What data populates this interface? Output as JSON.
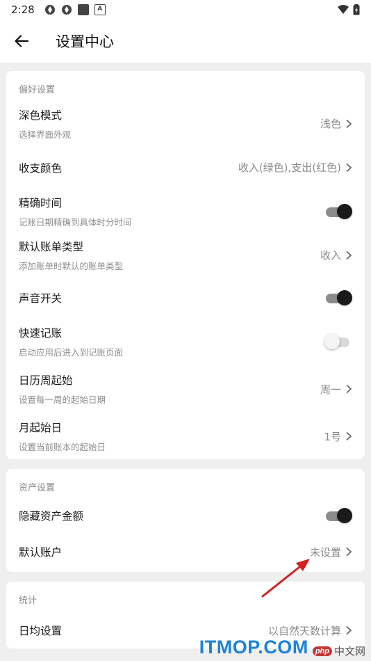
{
  "status_bar": {
    "time": "2:28"
  },
  "header": {
    "title": "设置中心"
  },
  "preferences": {
    "section_title": "偏好设置",
    "dark_mode": {
      "title": "深色模式",
      "subtitle": "选择界面外观",
      "value": "浅色"
    },
    "income_expense_color": {
      "title": "收支颜色",
      "value": "收入(绿色),支出(红色)"
    },
    "precise_time": {
      "title": "精确时间",
      "subtitle": "记账日期精确到具体时分时间",
      "enabled": true
    },
    "default_bill_type": {
      "title": "默认账单类型",
      "subtitle": "添加账单时默认的账单类型",
      "value": "收入"
    },
    "sound": {
      "title": "声音开关",
      "enabled": true
    },
    "quick_entry": {
      "title": "快速记账",
      "subtitle": "启动应用后进入到记账页面",
      "enabled": false
    },
    "week_start": {
      "title": "日历周起始",
      "subtitle": "设置每一周的起始日期",
      "value": "周一"
    },
    "month_start": {
      "title": "月起始日",
      "subtitle": "设置当前账本的起始日",
      "value": "1号"
    }
  },
  "assets": {
    "section_title": "资产设置",
    "hide_amount": {
      "title": "隐藏资产金额",
      "enabled": true
    },
    "default_account": {
      "title": "默认账户",
      "value": "未设置"
    }
  },
  "statistics": {
    "section_title": "统计",
    "daily_average": {
      "title": "日均设置",
      "value": "以自然天数计算"
    }
  },
  "watermark": {
    "main": "ITMOP.COM",
    "php": "php",
    "cn": "中文网"
  },
  "colors": {
    "annotation_arrow": "#d42020",
    "watermark": "#1b82d6"
  }
}
